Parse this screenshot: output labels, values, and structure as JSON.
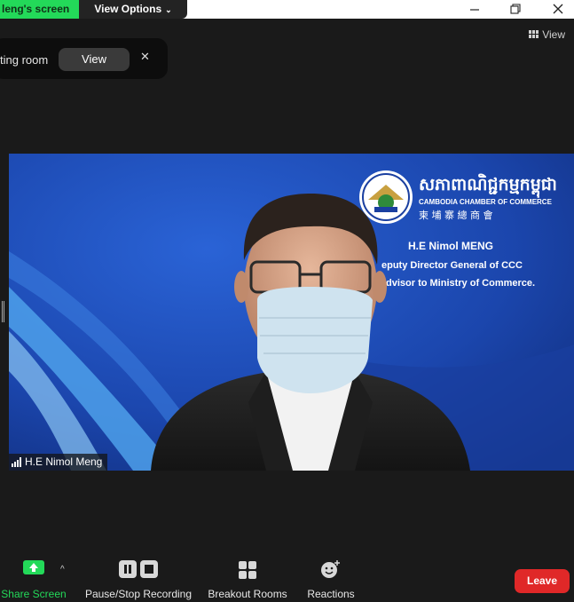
{
  "titlebar": {
    "share_tag": "leng's screen",
    "view_options": "View Options",
    "view_options_icon": "chevron-down-icon",
    "window_controls": [
      "minimize-icon",
      "restore-icon",
      "close-icon"
    ]
  },
  "top_view": {
    "label": "View",
    "icon": "grid-icon"
  },
  "notification": {
    "text": "ting room",
    "view_button": "View",
    "close": "✕"
  },
  "video": {
    "participant_name": "H.E Nimol MENG",
    "title_line1": "eputy Director General of CCC",
    "title_line2": "dvisor to Ministry of Commerce.",
    "org_english": "CAMBODIA CHAMBER OF COMMERCE",
    "org_khmer": "សភាពាណិជ្ជកម្មកម្ពុជា",
    "org_chinese": "柬 埔 寨 總 商 會",
    "colors": {
      "background": "#1d47b0",
      "accent": "#3b8fe0"
    }
  },
  "name_tag": {
    "name": "H.E Nimol Meng",
    "icon": "signal-strength-icon"
  },
  "toolbar": {
    "share_screen": "Share Screen",
    "caret": "^",
    "pause_stop_recording": "Pause/Stop Recording",
    "breakout_rooms": "Breakout Rooms",
    "reactions": "Reactions",
    "leave": "Leave",
    "colors": {
      "share": "#23d959",
      "leave": "#e02828"
    }
  }
}
